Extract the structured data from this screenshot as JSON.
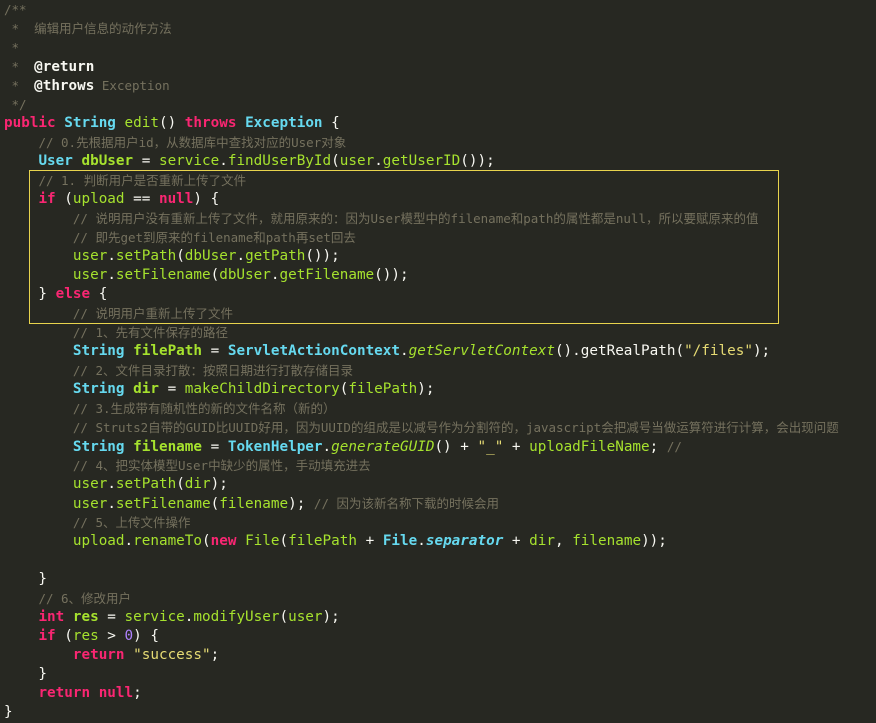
{
  "editor": {
    "highlight_color": "#E8D44D",
    "background": "#272822",
    "lines": [
      [
        {
          "t": "/**",
          "c": "cmt"
        }
      ],
      [
        {
          "t": " *  编辑用户信息的动作方法",
          "c": "cmt"
        }
      ],
      [
        {
          "t": " *",
          "c": "cmt"
        }
      ],
      [
        {
          "t": " *  ",
          "c": "cmt"
        },
        {
          "t": "@return",
          "c": "ann"
        }
      ],
      [
        {
          "t": " *  ",
          "c": "cmt"
        },
        {
          "t": "@throws",
          "c": "ann"
        },
        {
          "t": " Exception",
          "c": "cmt"
        }
      ],
      [
        {
          "t": " */",
          "c": "cmt"
        }
      ],
      [
        {
          "t": "public",
          "c": "kw"
        },
        {
          "t": " "
        },
        {
          "t": "String",
          "c": "type"
        },
        {
          "t": " "
        },
        {
          "t": "edit",
          "c": "fn"
        },
        {
          "t": "() "
        },
        {
          "t": "throws",
          "c": "kw"
        },
        {
          "t": " "
        },
        {
          "t": "Exception",
          "c": "type"
        },
        {
          "t": " {"
        }
      ],
      [
        {
          "t": "    "
        },
        {
          "t": "// 0.先根据用户id，从数据库中查找对应的User对象",
          "c": "cmt"
        }
      ],
      [
        {
          "t": "    "
        },
        {
          "t": "User",
          "c": "type"
        },
        {
          "t": " "
        },
        {
          "t": "dbUser",
          "c": "var"
        },
        {
          "t": " = "
        },
        {
          "t": "service",
          "c": "fn"
        },
        {
          "t": "."
        },
        {
          "t": "findUserById",
          "c": "fn"
        },
        {
          "t": "("
        },
        {
          "t": "user",
          "c": "fn"
        },
        {
          "t": "."
        },
        {
          "t": "getUserID",
          "c": "fn"
        },
        {
          "t": "());"
        }
      ],
      [
        {
          "t": "    "
        },
        {
          "t": "// 1. 判断用户是否重新上传了文件",
          "c": "cmt"
        }
      ],
      [
        {
          "t": "    "
        },
        {
          "t": "if",
          "c": "kw"
        },
        {
          "t": " ("
        },
        {
          "t": "upload",
          "c": "fn"
        },
        {
          "t": " == "
        },
        {
          "t": "null",
          "c": "kw"
        },
        {
          "t": ") {"
        }
      ],
      [
        {
          "t": "        "
        },
        {
          "t": "// 说明用户没有重新上传了文件，就用原来的：因为User模型中的filename和path的属性都是null，所以要赋原来的值",
          "c": "cmt"
        }
      ],
      [
        {
          "t": "        "
        },
        {
          "t": "// 即先get到原来的filename和path再set回去",
          "c": "cmt"
        }
      ],
      [
        {
          "t": "        "
        },
        {
          "t": "user",
          "c": "fn"
        },
        {
          "t": "."
        },
        {
          "t": "setPath",
          "c": "fn"
        },
        {
          "t": "("
        },
        {
          "t": "dbUser",
          "c": "fn"
        },
        {
          "t": "."
        },
        {
          "t": "getPath",
          "c": "fn"
        },
        {
          "t": "());"
        }
      ],
      [
        {
          "t": "        "
        },
        {
          "t": "user",
          "c": "fn"
        },
        {
          "t": "."
        },
        {
          "t": "setFilename",
          "c": "fn"
        },
        {
          "t": "("
        },
        {
          "t": "dbUser",
          "c": "fn"
        },
        {
          "t": "."
        },
        {
          "t": "getFilename",
          "c": "fn"
        },
        {
          "t": "());"
        }
      ],
      [
        {
          "t": "    } "
        },
        {
          "t": "else",
          "c": "kw"
        },
        {
          "t": " {"
        }
      ],
      [
        {
          "t": "        "
        },
        {
          "t": "// 说明用户重新上传了文件",
          "c": "cmt"
        }
      ],
      [
        {
          "t": "        "
        },
        {
          "t": "// 1、先有文件保存的路径",
          "c": "cmt"
        }
      ],
      [
        {
          "t": "        "
        },
        {
          "t": "String",
          "c": "type"
        },
        {
          "t": " "
        },
        {
          "t": "filePath",
          "c": "var"
        },
        {
          "t": " = "
        },
        {
          "t": "ServletActionContext",
          "c": "type"
        },
        {
          "t": "."
        },
        {
          "t": "getServletContext",
          "c": "fn it"
        },
        {
          "t": "()."
        },
        {
          "t": "getRealPath",
          "c": "op"
        },
        {
          "t": "("
        },
        {
          "t": "\"/files\"",
          "c": "str"
        },
        {
          "t": ");"
        }
      ],
      [
        {
          "t": "        "
        },
        {
          "t": "// 2、文件目录打散：按照日期进行打散存储目录",
          "c": "cmt"
        }
      ],
      [
        {
          "t": "        "
        },
        {
          "t": "String",
          "c": "type"
        },
        {
          "t": " "
        },
        {
          "t": "dir",
          "c": "var"
        },
        {
          "t": " = "
        },
        {
          "t": "makeChildDirectory",
          "c": "fn"
        },
        {
          "t": "("
        },
        {
          "t": "filePath",
          "c": "fn"
        },
        {
          "t": ");"
        }
      ],
      [
        {
          "t": "        "
        },
        {
          "t": "// 3.生成带有随机性的新的文件名称（新的）",
          "c": "cmt"
        }
      ],
      [
        {
          "t": "        "
        },
        {
          "t": "// Struts2自带的GUID比UUID好用，因为UUID的组成是以减号作为分割符的，javascript会把减号当做运算符进行计算，会出现问题",
          "c": "cmt"
        }
      ],
      [
        {
          "t": "        "
        },
        {
          "t": "String",
          "c": "type"
        },
        {
          "t": " "
        },
        {
          "t": "filename",
          "c": "var"
        },
        {
          "t": " = "
        },
        {
          "t": "TokenHelper",
          "c": "type"
        },
        {
          "t": "."
        },
        {
          "t": "generateGUID",
          "c": "fn it"
        },
        {
          "t": "() + "
        },
        {
          "t": "\"_\"",
          "c": "str"
        },
        {
          "t": " + "
        },
        {
          "t": "uploadFileName",
          "c": "fn"
        },
        {
          "t": "; "
        },
        {
          "t": "//",
          "c": "cmt"
        }
      ],
      [
        {
          "t": "        "
        },
        {
          "t": "// 4、把实体模型User中缺少的属性，手动填充进去",
          "c": "cmt"
        }
      ],
      [
        {
          "t": "        "
        },
        {
          "t": "user",
          "c": "fn"
        },
        {
          "t": "."
        },
        {
          "t": "setPath",
          "c": "fn"
        },
        {
          "t": "("
        },
        {
          "t": "dir",
          "c": "fn"
        },
        {
          "t": ");"
        }
      ],
      [
        {
          "t": "        "
        },
        {
          "t": "user",
          "c": "fn"
        },
        {
          "t": "."
        },
        {
          "t": "setFilename",
          "c": "fn"
        },
        {
          "t": "("
        },
        {
          "t": "filename",
          "c": "fn"
        },
        {
          "t": "); "
        },
        {
          "t": "// 因为该新名称下载的时候会用",
          "c": "cmt"
        }
      ],
      [
        {
          "t": "        "
        },
        {
          "t": "// 5、上传文件操作",
          "c": "cmt"
        }
      ],
      [
        {
          "t": "        "
        },
        {
          "t": "upload",
          "c": "fn"
        },
        {
          "t": "."
        },
        {
          "t": "renameTo",
          "c": "fn"
        },
        {
          "t": "("
        },
        {
          "t": "new",
          "c": "kw"
        },
        {
          "t": " "
        },
        {
          "t": "File",
          "c": "fn"
        },
        {
          "t": "("
        },
        {
          "t": "filePath",
          "c": "fn"
        },
        {
          "t": " + "
        },
        {
          "t": "File",
          "c": "type"
        },
        {
          "t": "."
        },
        {
          "t": "separator",
          "c": "type it"
        },
        {
          "t": " + "
        },
        {
          "t": "dir",
          "c": "fn"
        },
        {
          "t": ", "
        },
        {
          "t": "filename",
          "c": "fn"
        },
        {
          "t": "));"
        }
      ],
      [
        {
          "t": ""
        }
      ],
      [
        {
          "t": "    }"
        }
      ],
      [
        {
          "t": "    "
        },
        {
          "t": "// 6、修改用户",
          "c": "cmt"
        }
      ],
      [
        {
          "t": "    "
        },
        {
          "t": "int",
          "c": "kw"
        },
        {
          "t": " "
        },
        {
          "t": "res",
          "c": "var"
        },
        {
          "t": " = "
        },
        {
          "t": "service",
          "c": "fn"
        },
        {
          "t": "."
        },
        {
          "t": "modifyUser",
          "c": "fn"
        },
        {
          "t": "("
        },
        {
          "t": "user",
          "c": "fn"
        },
        {
          "t": ");"
        }
      ],
      [
        {
          "t": "    "
        },
        {
          "t": "if",
          "c": "kw"
        },
        {
          "t": " ("
        },
        {
          "t": "res",
          "c": "fn"
        },
        {
          "t": " > "
        },
        {
          "t": "0",
          "c": "num"
        },
        {
          "t": ") {"
        }
      ],
      [
        {
          "t": "        "
        },
        {
          "t": "return",
          "c": "kw"
        },
        {
          "t": " "
        },
        {
          "t": "\"success\"",
          "c": "str"
        },
        {
          "t": ";"
        }
      ],
      [
        {
          "t": "    }"
        }
      ],
      [
        {
          "t": "    "
        },
        {
          "t": "return",
          "c": "kw"
        },
        {
          "t": " "
        },
        {
          "t": "null",
          "c": "kw"
        },
        {
          "t": ";"
        }
      ],
      [
        {
          "t": "}"
        }
      ]
    ]
  }
}
